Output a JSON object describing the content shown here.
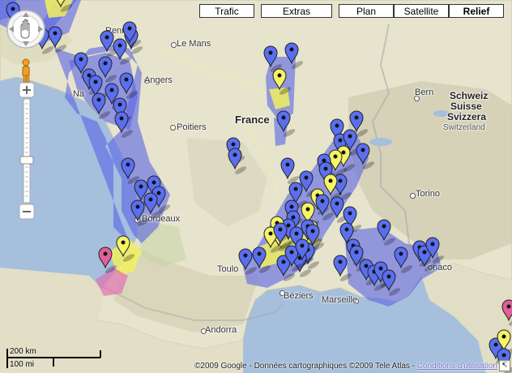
{
  "map_types": {
    "traffic": "Trafic",
    "extras": "Extras",
    "plan": "Plan",
    "satellite": "Satellite",
    "relief": "Relief",
    "active": "relief"
  },
  "places": {
    "rennes": "Rennes",
    "le_mans": "Le Mans",
    "angers": "Angers",
    "nantes": "Na",
    "poitiers": "Poitiers",
    "france": "France",
    "bordeaux": "Bordeaux",
    "toulouse": "Toulo",
    "beziers": "Béziers",
    "marseille": "Marseille",
    "andorra": "Andorra",
    "bern": "Bern",
    "schweiz": "Schweiz",
    "suisse": "Suisse",
    "svizzera": "Svizzera",
    "switzerland": "Switzerland",
    "torino": "Torino",
    "monaco": "onaco"
  },
  "scale": {
    "km": "200 km",
    "mi": "100 mi"
  },
  "copyright": {
    "text": "©2009 Google - Données cartographiques ©2009 Tele Atlas - ",
    "link": "Conditions d'utilisation"
  },
  "colors": {
    "marker_blue": "#5a6ff0",
    "marker_yellow": "#f4f466",
    "marker_pink": "#e0609a",
    "region_blue": "#5a64e6",
    "region_yellow": "#f0f060",
    "region_pink": "#e070b0",
    "sea": "#a5bfdd",
    "land": "#e8e6d2"
  },
  "icons": {
    "pan": "pan-hand-icon",
    "pegman": "pegman-icon",
    "zoom_in": "zoom-in-icon",
    "zoom_out": "zoom-out-icon"
  }
}
